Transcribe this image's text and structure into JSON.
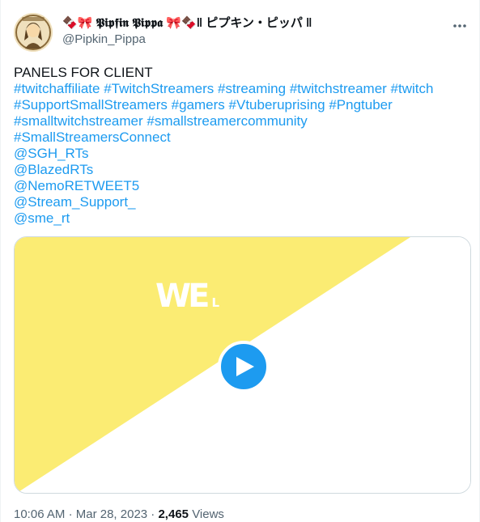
{
  "author": {
    "display_name": "🍫🎀 𝕻𝖎𝖕𝖋𝖎𝖓 𝕻𝖎𝖕𝖕𝖆 🎀🍫‖ ピプキン・ピッパ ‖",
    "handle": "@Pipkin_Pippa",
    "avatar_icon": "avatar-illustration"
  },
  "more_icon": "more-horizontal-icon",
  "tweet": {
    "heading": "PANELS FOR CLIENT",
    "hashtag_lines": [
      [
        "#twitchaffiliate",
        "#TwitchStreamers",
        "#streaming",
        "#twitchstreamer",
        "#twitch"
      ],
      [
        "#SupportSmallStreamers",
        "#gamers",
        "#Vtuberuprising",
        "#Pngtuber"
      ],
      [
        "#smalltwitchstreamer",
        "#smallstreamercommunity"
      ],
      [
        "#SmallStreamersConnect"
      ]
    ],
    "mentions": [
      "@SGH_RTs",
      "@BlazedRTs",
      "@NemoRETWEET5",
      "@Stream_Support_",
      "@sme_rt"
    ]
  },
  "media": {
    "overlay_text_big": "WE",
    "overlay_text_small": "L",
    "play_icon": "play-icon",
    "colors": {
      "yellow": "#fbec73",
      "white": "#ffffff",
      "play": "#1d9bf0"
    }
  },
  "meta": {
    "time": "10:06 AM",
    "separator": "·",
    "date": "Mar 28, 2023",
    "views_count": "2,465",
    "views_label": "Views"
  },
  "colors": {
    "link": "#1d9bf0",
    "text": "#0f1419",
    "secondary": "#536471"
  }
}
